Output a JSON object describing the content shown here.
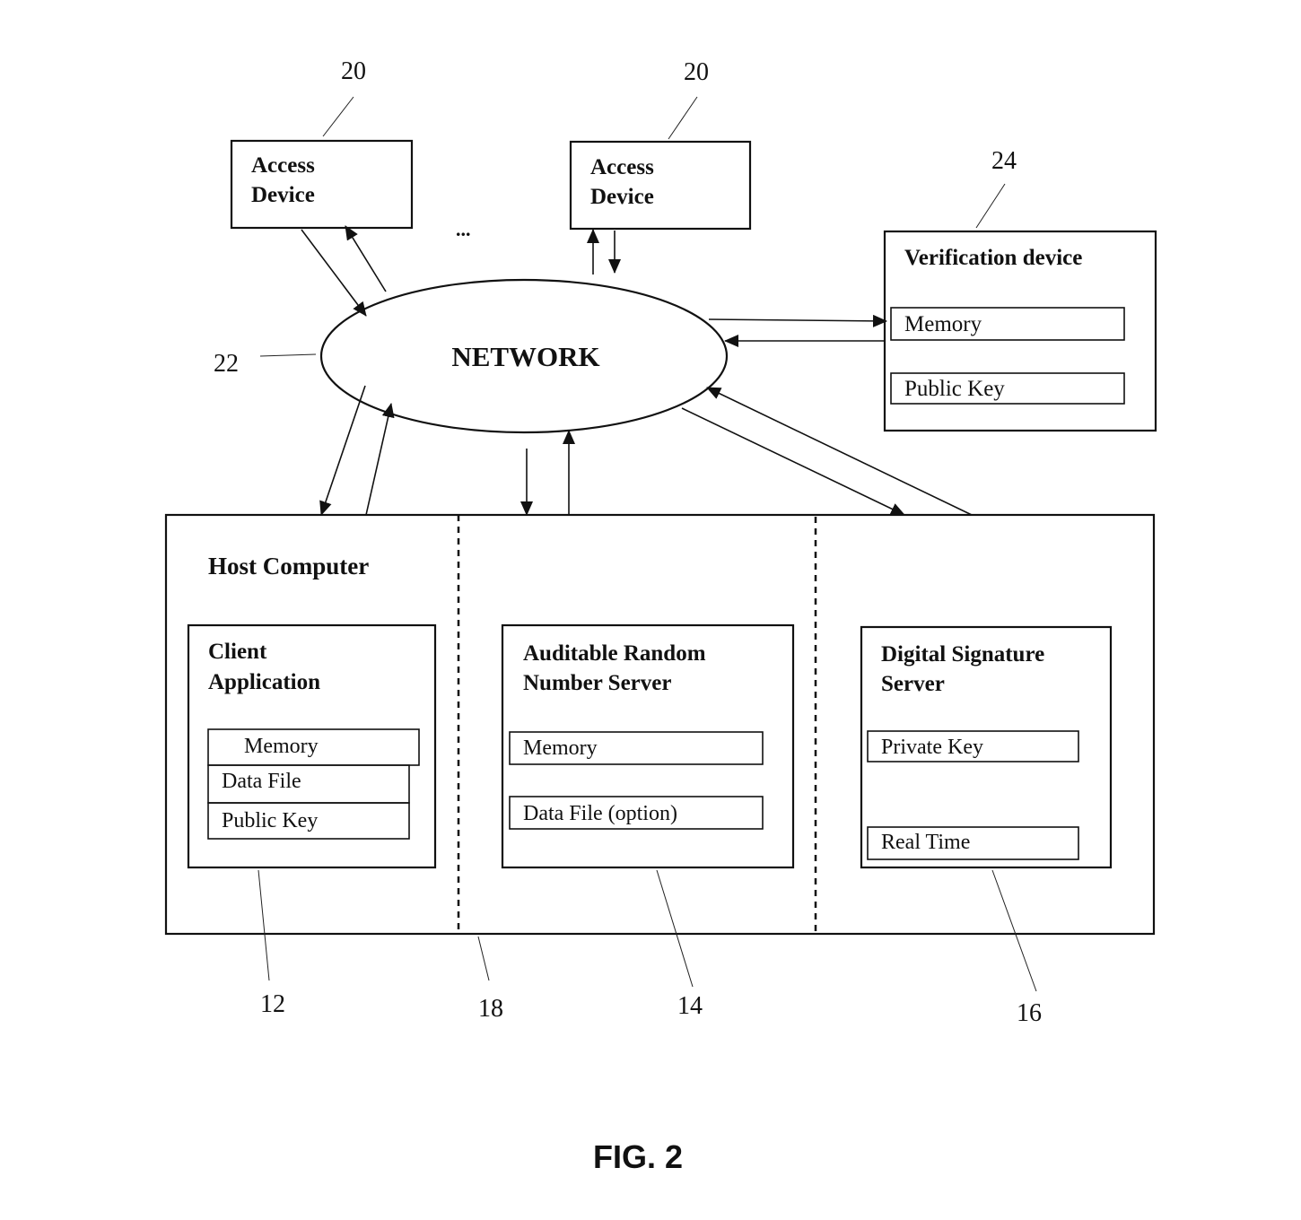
{
  "figure": {
    "caption": "FIG. 2"
  },
  "network": {
    "label": "NETWORK",
    "ref": "22"
  },
  "access_devices": [
    {
      "line1": "Access",
      "line2": "Device",
      "ref": "20"
    },
    {
      "line1": "Access",
      "line2": "Device",
      "ref": "20"
    }
  ],
  "ellipsis": "...",
  "verification_device": {
    "title": "Verification device",
    "ref": "24",
    "fields": [
      "Memory",
      "Public Key"
    ]
  },
  "host_computer": {
    "title": "Host Computer",
    "partition_ref": "18",
    "client_application": {
      "line1": "Client",
      "line2": "Application",
      "ref": "12",
      "fields": [
        "Memory",
        "Data File",
        "Public Key"
      ]
    },
    "random_number_server": {
      "line1": "Auditable Random",
      "line2": "Number Server",
      "ref": "14",
      "fields": [
        "Memory",
        "Data File (option)"
      ]
    },
    "signature_server": {
      "line1": "Digital Signature",
      "line2": "Server",
      "ref": "16",
      "fields": [
        "Private Key",
        "Real Time"
      ]
    }
  }
}
